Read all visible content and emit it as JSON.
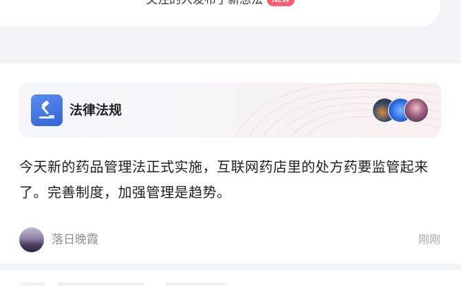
{
  "top_card": {
    "text": "关注的人发布了新想法",
    "badge": "NEW"
  },
  "post": {
    "topic": {
      "title": "法律法规",
      "icon": "gavel-icon"
    },
    "body": "今天新的药品管理法正式实施，互联网药店里的处方药要监管起来了。完善制度，加强管理是趋势。",
    "author": {
      "name": "落日晚霞"
    },
    "time": "刚刚"
  },
  "colors": {
    "topic_icon": "#3d6fe0",
    "badge_new": "#ff5a6e",
    "meta_text": "#8d8d93"
  }
}
